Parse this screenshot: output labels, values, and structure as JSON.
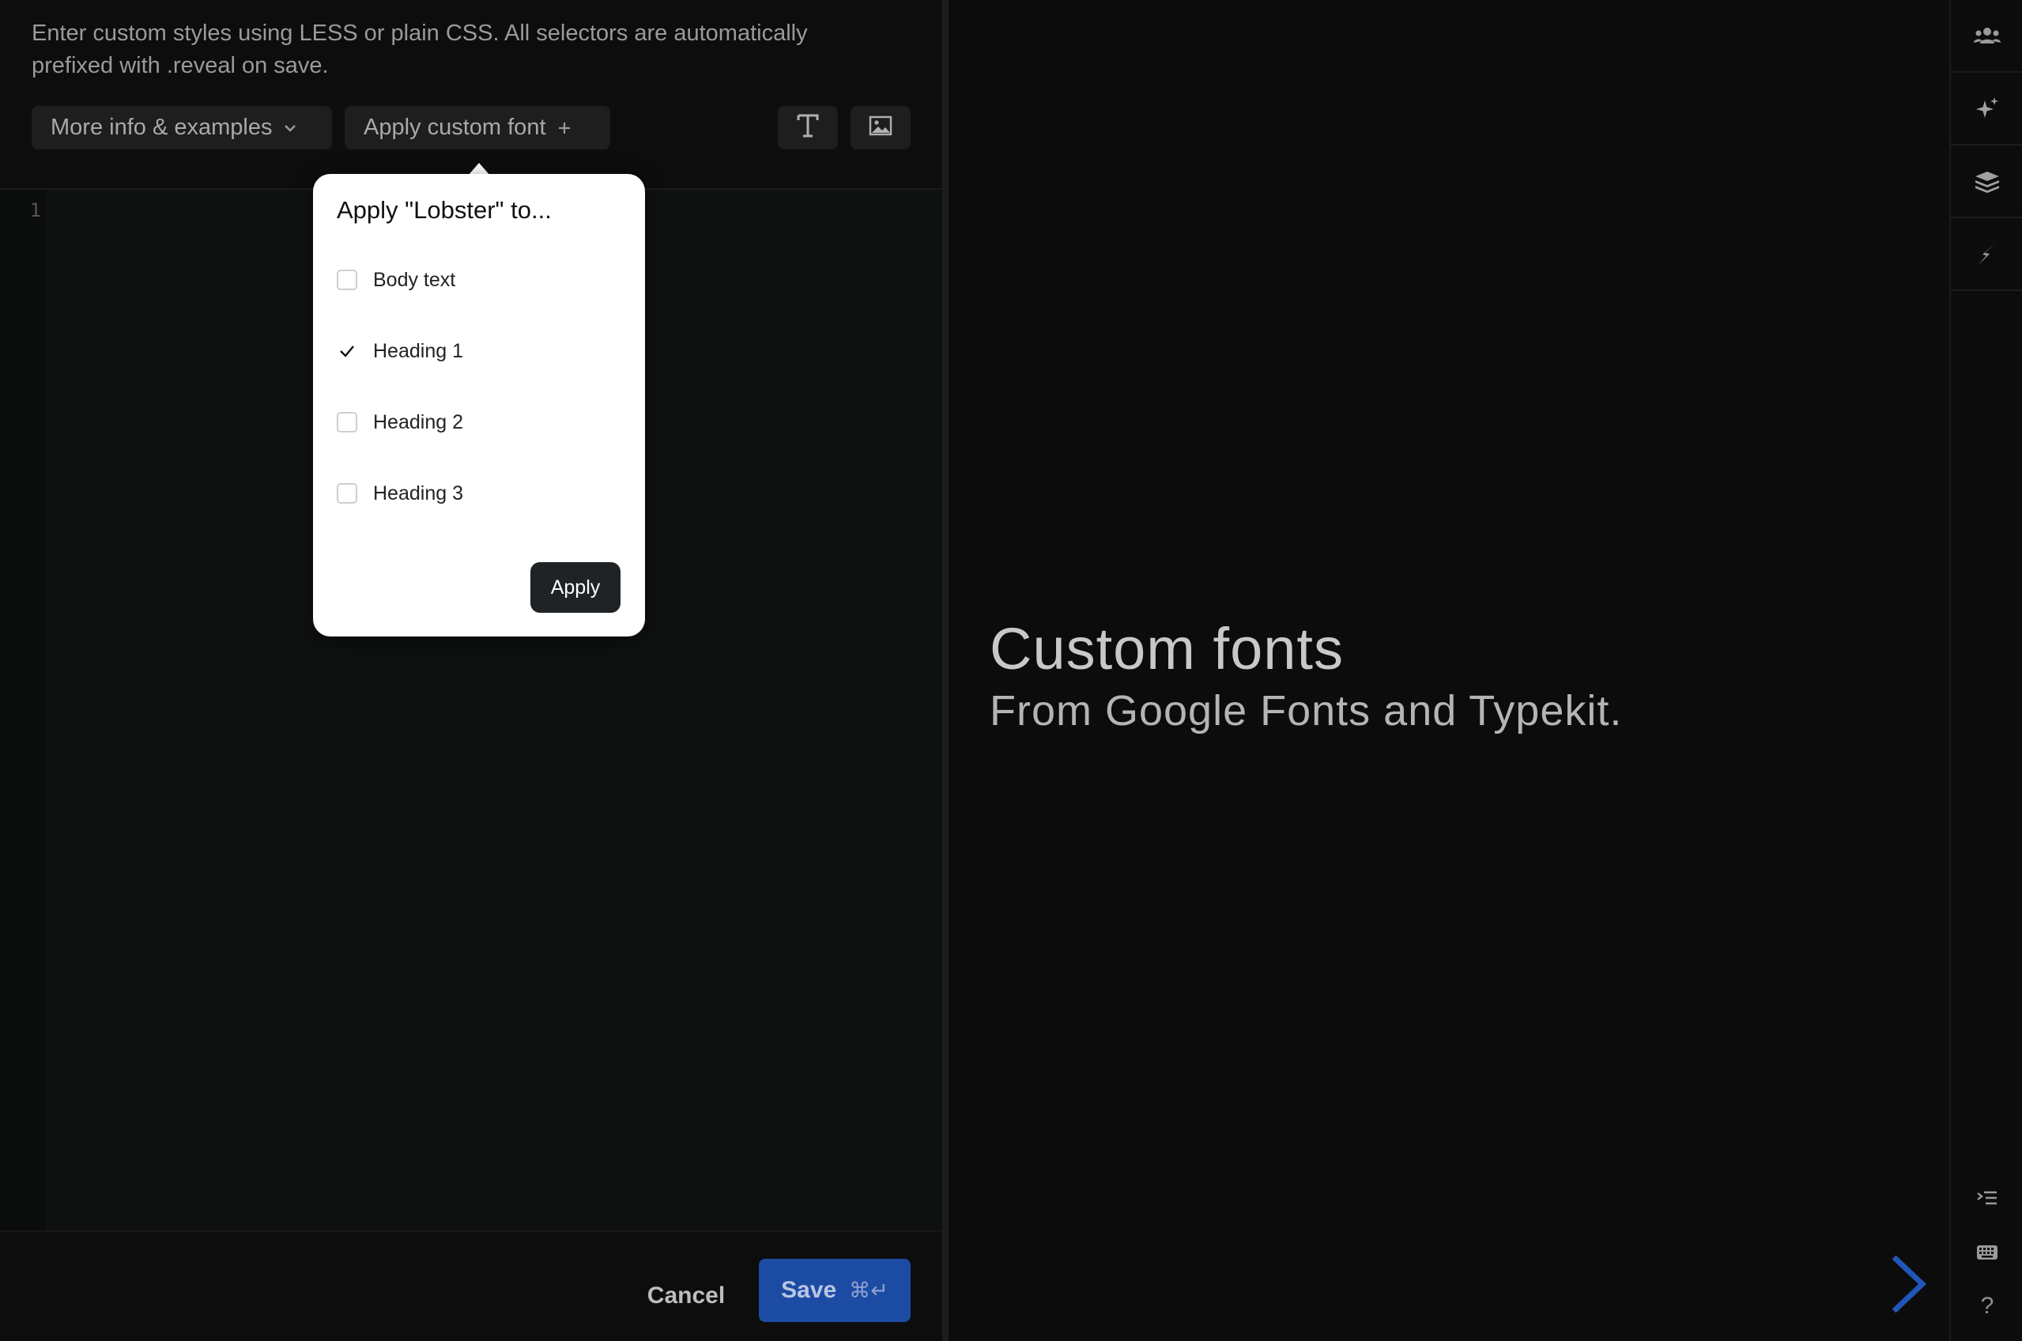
{
  "editor": {
    "description": "Enter custom styles using LESS or plain CSS. All selectors are automatically prefixed with .reveal on save.",
    "more_info_label": "More info & examples",
    "apply_font_label": "Apply custom font",
    "line_number": "1",
    "text_icon": "text-type-icon",
    "image_icon": "image-icon"
  },
  "popover": {
    "title": "Apply \"Lobster\" to...",
    "options": [
      {
        "label": "Body text",
        "checked": false
      },
      {
        "label": "Heading 1",
        "checked": true
      },
      {
        "label": "Heading 2",
        "checked": false
      },
      {
        "label": "Heading 3",
        "checked": false
      }
    ],
    "apply_label": "Apply"
  },
  "footer": {
    "cancel_label": "Cancel",
    "save_label": "Save",
    "save_shortcut": "⌘↵"
  },
  "preview": {
    "heading": "Custom fonts",
    "subheading": "From Google Fonts and Typekit."
  },
  "sidebar": {
    "items": [
      "collaborators-icon",
      "sparkle-icon",
      "layers-icon",
      "lightning-icon"
    ],
    "bottom": [
      "outline-icon",
      "keyboard-icon",
      "help-icon"
    ],
    "help_label": "?"
  },
  "colors": {
    "save_button": "#1c4ba4",
    "next_arrow": "#1f56b8",
    "popover_bg": "#ffffff",
    "apply_button": "#1f2326"
  }
}
